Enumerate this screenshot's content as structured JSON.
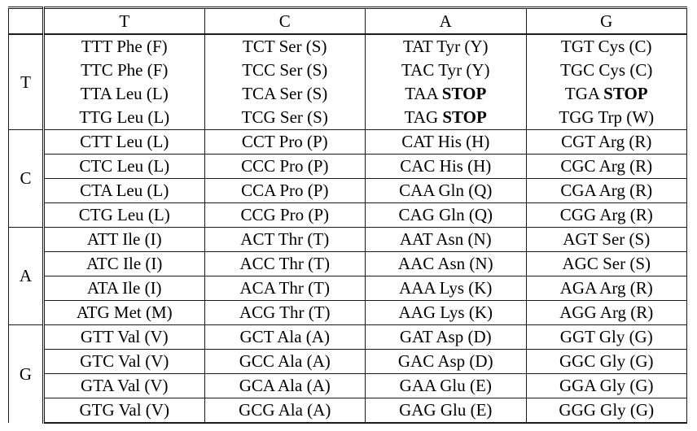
{
  "table": {
    "corner_label": "",
    "column_headers": [
      "T",
      "C",
      "A",
      "G"
    ],
    "row_labels": [
      "T",
      "C",
      "A",
      "G"
    ],
    "blocks": [
      {
        "row_label": "T",
        "rows": [
          [
            {
              "codon": "TTT",
              "amino": "Phe (F)",
              "stop": false
            },
            {
              "codon": "TCT",
              "amino": "Ser (S)",
              "stop": false
            },
            {
              "codon": "TAT",
              "amino": "Tyr (Y)",
              "stop": false
            },
            {
              "codon": "TGT",
              "amino": "Cys (C)",
              "stop": false
            }
          ],
          [
            {
              "codon": "TTC",
              "amino": "Phe (F)",
              "stop": false
            },
            {
              "codon": "TCC",
              "amino": "Ser (S)",
              "stop": false
            },
            {
              "codon": "TAC",
              "amino": "Tyr (Y)",
              "stop": false
            },
            {
              "codon": "TGC",
              "amino": "Cys (C)",
              "stop": false
            }
          ],
          [
            {
              "codon": "TTA",
              "amino": "Leu (L)",
              "stop": false
            },
            {
              "codon": "TCA",
              "amino": "Ser (S)",
              "stop": false
            },
            {
              "codon": "TAA",
              "amino": "STOP",
              "stop": true
            },
            {
              "codon": "TGA",
              "amino": "STOP",
              "stop": true
            }
          ],
          [
            {
              "codon": "TTG",
              "amino": "Leu (L)",
              "stop": false
            },
            {
              "codon": "TCG",
              "amino": "Ser (S)",
              "stop": false
            },
            {
              "codon": "TAG",
              "amino": "STOP",
              "stop": true
            },
            {
              "codon": "TGG",
              "amino": "Trp (W)",
              "stop": false
            }
          ]
        ]
      },
      {
        "row_label": "C",
        "rows": [
          [
            {
              "codon": "CTT",
              "amino": "Leu (L)",
              "stop": false
            },
            {
              "codon": "CCT",
              "amino": "Pro (P)",
              "stop": false
            },
            {
              "codon": "CAT",
              "amino": "His (H)",
              "stop": false
            },
            {
              "codon": "CGT",
              "amino": "Arg (R)",
              "stop": false
            }
          ],
          [
            {
              "codon": "CTC",
              "amino": "Leu (L)",
              "stop": false
            },
            {
              "codon": "CCC",
              "amino": "Pro (P)",
              "stop": false
            },
            {
              "codon": "CAC",
              "amino": "His (H)",
              "stop": false
            },
            {
              "codon": "CGC",
              "amino": "Arg (R)",
              "stop": false
            }
          ],
          [
            {
              "codon": "CTA",
              "amino": "Leu (L)",
              "stop": false
            },
            {
              "codon": "CCA",
              "amino": "Pro (P)",
              "stop": false
            },
            {
              "codon": "CAA",
              "amino": "Gln (Q)",
              "stop": false
            },
            {
              "codon": "CGA",
              "amino": "Arg (R)",
              "stop": false
            }
          ],
          [
            {
              "codon": "CTG",
              "amino": "Leu (L)",
              "stop": false
            },
            {
              "codon": "CCG",
              "amino": "Pro (P)",
              "stop": false
            },
            {
              "codon": "CAG",
              "amino": "Gln (Q)",
              "stop": false
            },
            {
              "codon": "CGG",
              "amino": "Arg (R)",
              "stop": false
            }
          ]
        ]
      },
      {
        "row_label": "A",
        "rows": [
          [
            {
              "codon": "ATT",
              "amino": "Ile (I)",
              "stop": false
            },
            {
              "codon": "ACT",
              "amino": "Thr (T)",
              "stop": false
            },
            {
              "codon": "AAT",
              "amino": "Asn (N)",
              "stop": false
            },
            {
              "codon": "AGT",
              "amino": "Ser (S)",
              "stop": false
            }
          ],
          [
            {
              "codon": "ATC",
              "amino": "Ile (I)",
              "stop": false
            },
            {
              "codon": "ACC",
              "amino": "Thr (T)",
              "stop": false
            },
            {
              "codon": "AAC",
              "amino": "Asn (N)",
              "stop": false
            },
            {
              "codon": "AGC",
              "amino": "Ser (S)",
              "stop": false
            }
          ],
          [
            {
              "codon": "ATA",
              "amino": "Ile (I)",
              "stop": false
            },
            {
              "codon": "ACA",
              "amino": "Thr (T)",
              "stop": false
            },
            {
              "codon": "AAA",
              "amino": "Lys (K)",
              "stop": false
            },
            {
              "codon": "AGA",
              "amino": "Arg (R)",
              "stop": false
            }
          ],
          [
            {
              "codon": "ATG",
              "amino": "Met (M)",
              "stop": false
            },
            {
              "codon": "ACG",
              "amino": "Thr (T)",
              "stop": false
            },
            {
              "codon": "AAG",
              "amino": "Lys (K)",
              "stop": false
            },
            {
              "codon": "AGG",
              "amino": "Arg (R)",
              "stop": false
            }
          ]
        ]
      },
      {
        "row_label": "G",
        "rows": [
          [
            {
              "codon": "GTT",
              "amino": "Val (V)",
              "stop": false
            },
            {
              "codon": "GCT",
              "amino": "Ala (A)",
              "stop": false
            },
            {
              "codon": "GAT",
              "amino": "Asp (D)",
              "stop": false
            },
            {
              "codon": "GGT",
              "amino": "Gly (G)",
              "stop": false
            }
          ],
          [
            {
              "codon": "GTC",
              "amino": "Val (V)",
              "stop": false
            },
            {
              "codon": "GCC",
              "amino": "Ala (A)",
              "stop": false
            },
            {
              "codon": "GAC",
              "amino": "Asp (D)",
              "stop": false
            },
            {
              "codon": "GGC",
              "amino": "Gly (G)",
              "stop": false
            }
          ],
          [
            {
              "codon": "GTA",
              "amino": "Val (V)",
              "stop": false
            },
            {
              "codon": "GCA",
              "amino": "Ala (A)",
              "stop": false
            },
            {
              "codon": "GAA",
              "amino": "Glu (E)",
              "stop": false
            },
            {
              "codon": "GGA",
              "amino": "Gly (G)",
              "stop": false
            }
          ],
          [
            {
              "codon": "GTG",
              "amino": "Val (V)",
              "stop": false
            },
            {
              "codon": "GCG",
              "amino": "Ala (A)",
              "stop": false
            },
            {
              "codon": "GAG",
              "amino": "Glu (E)",
              "stop": false
            },
            {
              "codon": "GGG",
              "amino": "Gly (G)",
              "stop": false
            }
          ]
        ]
      }
    ]
  },
  "colors": {
    "rule": "#1a1a1a",
    "text": "#000000",
    "background": "#ffffff"
  }
}
